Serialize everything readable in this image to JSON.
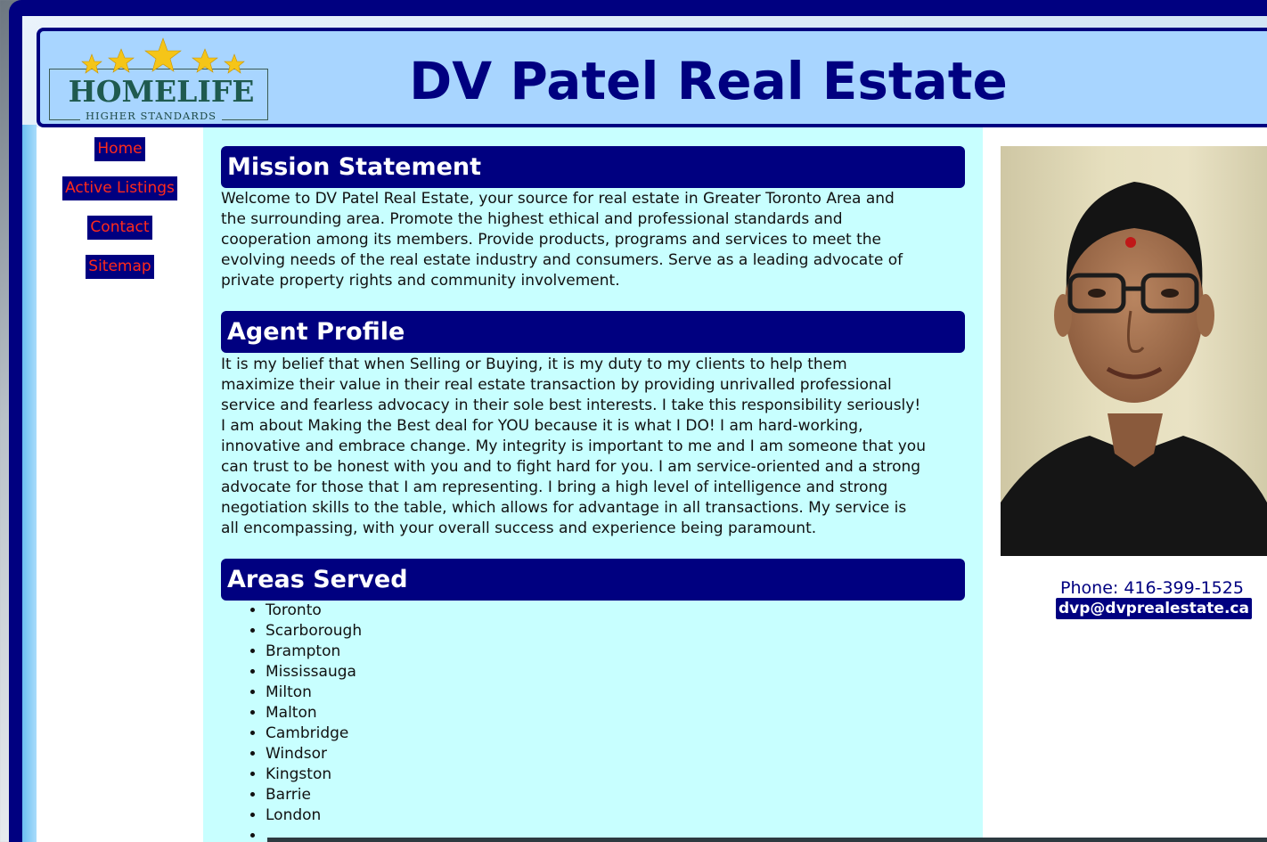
{
  "header": {
    "title": "DV Patel Real Estate",
    "logo": {
      "word": "HOMELIFE",
      "tagline": "HIGHER STANDARDS",
      "star_color": "#f5c518"
    }
  },
  "nav": {
    "items": [
      {
        "label": "Home"
      },
      {
        "label": "Active Listings"
      },
      {
        "label": "Contact"
      },
      {
        "label": "Sitemap"
      }
    ]
  },
  "main": {
    "sections": [
      {
        "heading": "Mission Statement",
        "lines": [
          "Welcome to DV Patel Real Estate, your source for real estate in Greater Toronto Area and",
          "the surrounding area. Promote the highest ethical and professional standards and",
          "cooperation among its members. Provide products, programs and services to meet the",
          "evolving needs of the real estate industry and consumers. Serve as a leading advocate of",
          "private property rights and community involvement."
        ]
      },
      {
        "heading": "Agent Profile",
        "lines": [
          "It is my belief that when Selling or Buying, it is my duty to my clients to help them",
          "maximize their value in their real estate transaction by providing unrivalled professional",
          "service and fearless advocacy in their sole best interests. I take this responsibility seriously!",
          "I am about Making the Best deal for YOU because it is what I DO! I am hard-working,",
          "innovative and embrace change. My integrity is important to me and I am someone that you",
          "can trust to be honest with you and to fight hard for you. I am service-oriented and a strong",
          "advocate for those that I am representing. I bring a high level of intelligence and strong",
          "negotiation skills to the table, which allows for advantage in all transactions. My service is",
          "all encompassing, with your overall success and experience being paramount."
        ]
      },
      {
        "heading": "Areas Served",
        "areas": [
          "Toronto",
          "Scarborough",
          "Brampton",
          "Mississauga",
          "Milton",
          "Malton",
          "Cambridge",
          "Windsor",
          "Kingston",
          "Barrie",
          "London"
        ]
      }
    ]
  },
  "contact": {
    "phone": "Phone: 416-399-1525",
    "email": "dvp@dvprealestate.ca"
  },
  "colors": {
    "navy": "#000080",
    "header_bg": "#a8d5ff",
    "main_bg": "#c8ffff",
    "nav_text": "#ff2a1a"
  }
}
